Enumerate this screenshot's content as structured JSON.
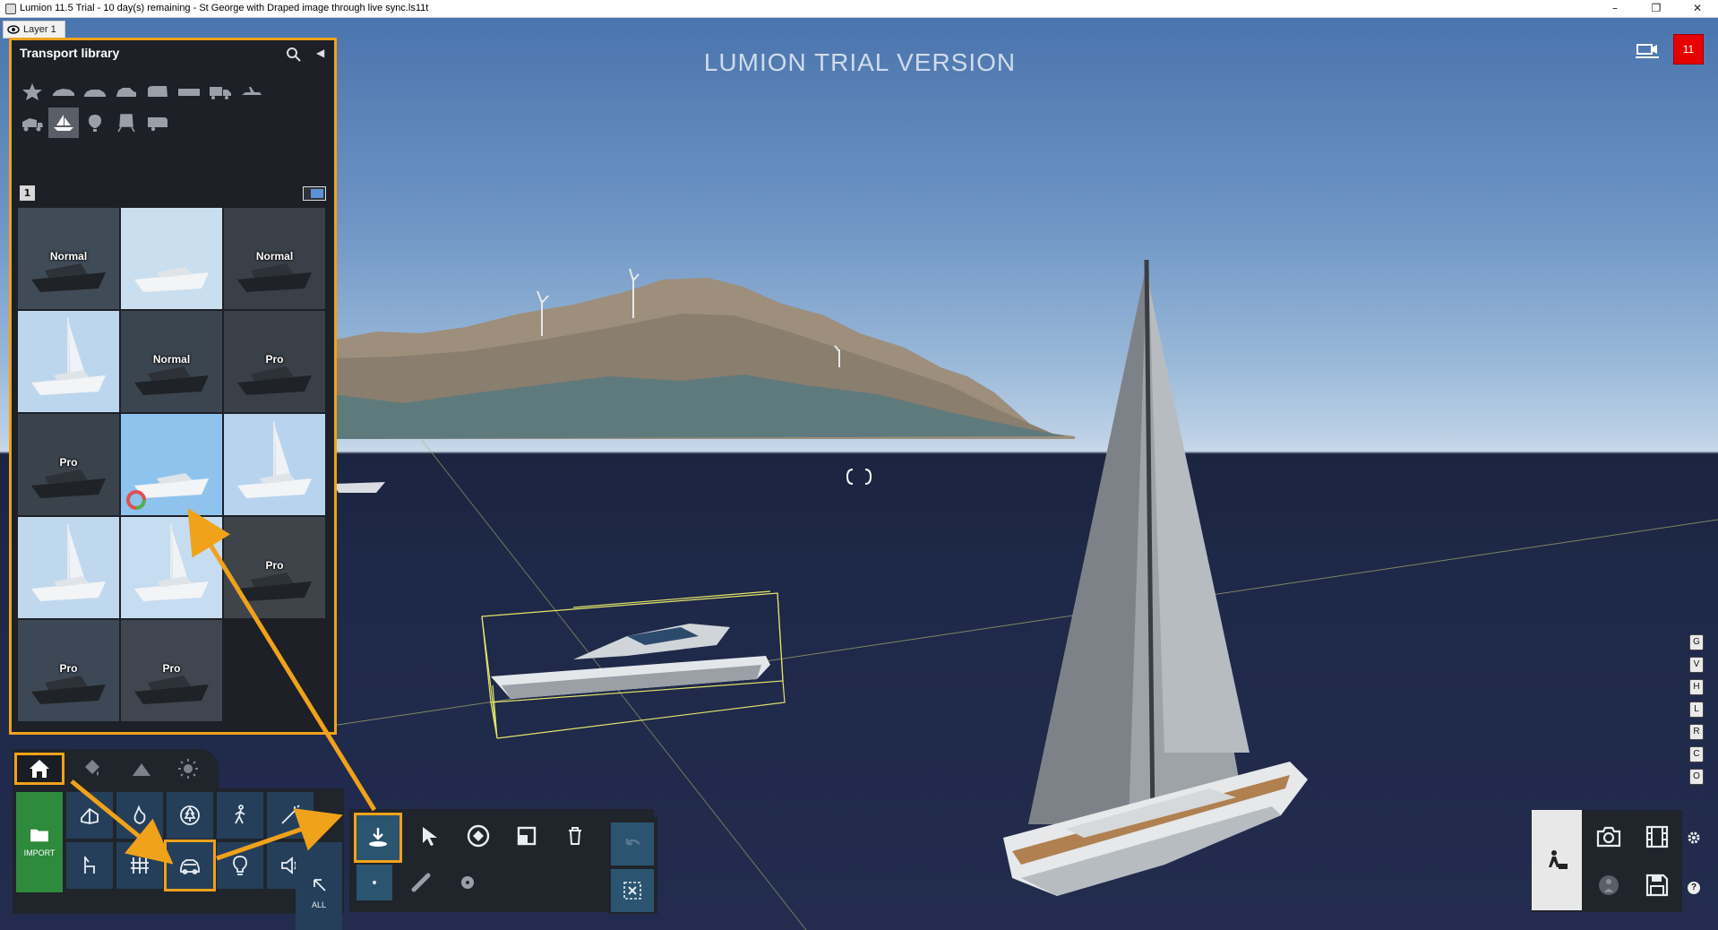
{
  "window": {
    "title": "Lumion 11.5 Trial - 10 day(s) remaining - St George with Draped image through live sync.ls11t",
    "minimize": "–",
    "restore": "❐",
    "close": "✕"
  },
  "viewport": {
    "layer_label": "Layer 1",
    "watermark": "LUMION TRIAL VERSION",
    "notification_count": "11"
  },
  "library": {
    "title": "Transport library",
    "page": "1",
    "categories": [
      {
        "icon": "favorites-star-icon",
        "active": false
      },
      {
        "icon": "sports-car-icon",
        "active": false
      },
      {
        "icon": "sedan-icon",
        "active": false
      },
      {
        "icon": "hatchback-icon",
        "active": false
      },
      {
        "icon": "van-icon",
        "active": false
      },
      {
        "icon": "bus-icon",
        "active": false
      },
      {
        "icon": "truck-icon",
        "active": false
      },
      {
        "icon": "aircraft-icon",
        "active": false
      },
      {
        "icon": "heavy-vehicle-icon",
        "active": false
      },
      {
        "icon": "boat-icon",
        "active": true
      },
      {
        "icon": "balloon-icon",
        "active": false
      },
      {
        "icon": "train-icon",
        "active": false
      },
      {
        "icon": "caravan-icon",
        "active": false
      }
    ],
    "items": [
      {
        "name": "fishing-boat",
        "badge": "Normal",
        "bg": "#3f4b57"
      },
      {
        "name": "white-speedboat",
        "badge": "",
        "bg": "#c9dff0"
      },
      {
        "name": "dark-speedboat",
        "badge": "Normal",
        "bg": "#3a4048"
      },
      {
        "name": "sailboat-white",
        "badge": "",
        "bg": "#bcd6ee"
      },
      {
        "name": "red-tug",
        "badge": "Normal",
        "bg": "#3b4550"
      },
      {
        "name": "rib-boat",
        "badge": "Pro",
        "bg": "#3a4047"
      },
      {
        "name": "dark-trawler",
        "badge": "Pro",
        "bg": "#3a424b"
      },
      {
        "name": "motor-yacht",
        "badge": "",
        "bg": "#8ec3ee"
      },
      {
        "name": "sailboat-tall",
        "badge": "",
        "bg": "#b8d3ee"
      },
      {
        "name": "sloop",
        "badge": "",
        "bg": "#c0d8ee"
      },
      {
        "name": "catamaran",
        "badge": "",
        "bg": "#c6dcf0"
      },
      {
        "name": "power-catamaran",
        "badge": "Pro",
        "bg": "#3f444b"
      },
      {
        "name": "teal-tug",
        "badge": "Pro",
        "bg": "#3c4856"
      },
      {
        "name": "red-tugboat",
        "badge": "Pro",
        "bg": "#3f464f"
      }
    ]
  },
  "toolbar": {
    "import_label": "IMPORT",
    "all_label": "ALL"
  },
  "shortcut_keys": [
    "G",
    "V",
    "H",
    "L",
    "R",
    "C",
    "O"
  ],
  "help_label": "?",
  "colors": {
    "highlight": "#f0a21a",
    "notification": "#e60000",
    "import_green": "#2e8a3c",
    "tool_blue": "#253f5a"
  }
}
